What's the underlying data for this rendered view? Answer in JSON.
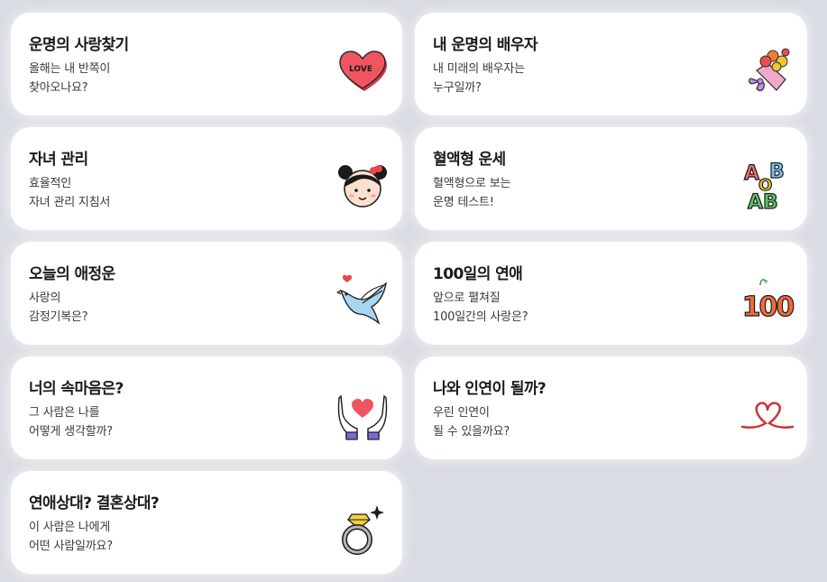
{
  "cards": [
    {
      "title": "운명의 사랑찾기",
      "desc": "올해는 내 반쪽이\n찾아오나요?",
      "icon": "love-heart-icon",
      "badge": "LOVE"
    },
    {
      "title": "내 운명의 배우자",
      "desc": "내 미래의 배우자는\n누구일까?",
      "icon": "flower-bouquet-icon"
    },
    {
      "title": "자녀 관리",
      "desc": "효율적인\n자녀 관리 지침서",
      "icon": "girl-face-icon"
    },
    {
      "title": "혈액형 운세",
      "desc": "혈액형으로 보는\n운명 테스트!",
      "icon": "blood-type-letters-icon",
      "letters": [
        "A",
        "B",
        "O",
        "AB"
      ]
    },
    {
      "title": "오늘의 애정운",
      "desc": "사랑의\n감정기복은?",
      "icon": "bird-with-heart-icon"
    },
    {
      "title": "100일의 연애",
      "desc": "앞으로 펼쳐질\n100일간의 사랑은?",
      "icon": "hundred-days-icon",
      "number": "100"
    },
    {
      "title": "너의 속마음은?",
      "desc": "그 사람은 나를\n어떻게 생각할까?",
      "icon": "hands-holding-heart-icon"
    },
    {
      "title": "나와 인연이 될까?",
      "desc": "우린 인연이\n될 수 있을까요?",
      "icon": "red-string-heart-icon"
    },
    {
      "title": "연애상대? 결혼상대?",
      "desc": "이 사람은 나에게\n어떤 사람일까요?",
      "icon": "diamond-ring-icon"
    }
  ]
}
